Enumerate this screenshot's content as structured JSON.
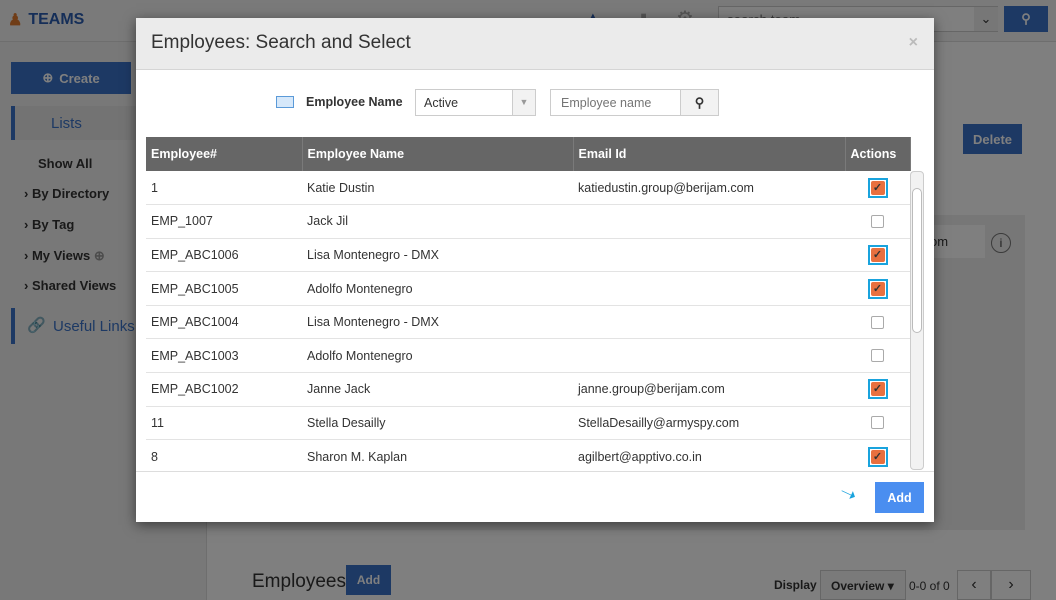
{
  "app": {
    "title": "TEAMS",
    "search_placeholder": "search team"
  },
  "sidebar": {
    "create_label": "Create",
    "lists_label": "Lists",
    "items": [
      {
        "label": "Show All"
      },
      {
        "label": "By Directory"
      },
      {
        "label": "By Tag"
      },
      {
        "label": "My Views"
      },
      {
        "label": "Shared Views"
      }
    ],
    "useful_links_label": "Useful Links"
  },
  "main": {
    "delete_label": "Delete",
    "partial_text": "om",
    "section_title": "Employees",
    "add_label": "Add",
    "display_label": "Display",
    "display_value": "Overview",
    "pagination": "0-0 of 0"
  },
  "modal": {
    "title": "Employees: Search and Select",
    "close": "×",
    "filter_label": "Employee Name",
    "status_value": "Active",
    "search_placeholder": "Employee name",
    "columns": [
      "Employee#",
      "Employee Name",
      "Email Id",
      "Actions"
    ],
    "rows": [
      {
        "id": "1",
        "name": "Katie Dustin",
        "email": "katiedustin.group@berijam.com",
        "checked": true
      },
      {
        "id": "EMP_1007",
        "name": "Jack Jil",
        "email": "",
        "checked": false
      },
      {
        "id": "EMP_ABC1006",
        "name": "Lisa Montenegro - DMX",
        "email": "",
        "checked": true
      },
      {
        "id": "EMP_ABC1005",
        "name": "Adolfo Montenegro",
        "email": "",
        "checked": true
      },
      {
        "id": "EMP_ABC1004",
        "name": "Lisa Montenegro - DMX",
        "email": "",
        "checked": false
      },
      {
        "id": "EMP_ABC1003",
        "name": "Adolfo Montenegro",
        "email": "",
        "checked": false
      },
      {
        "id": "EMP_ABC1002",
        "name": "Janne Jack",
        "email": "janne.group@berijam.com",
        "checked": true
      },
      {
        "id": "11",
        "name": "Stella Desailly",
        "email": "StellaDesailly@armyspy.com",
        "checked": false
      },
      {
        "id": "8",
        "name": "Sharon M. Kaplan",
        "email": "agilbert@apptivo.co.in",
        "checked": true
      }
    ],
    "add_label": "Add",
    "colors": {
      "accent": "#4a8ef0",
      "checkbox_highlight": "#19a3dd",
      "checkbox_fill": "#e8703f"
    }
  }
}
